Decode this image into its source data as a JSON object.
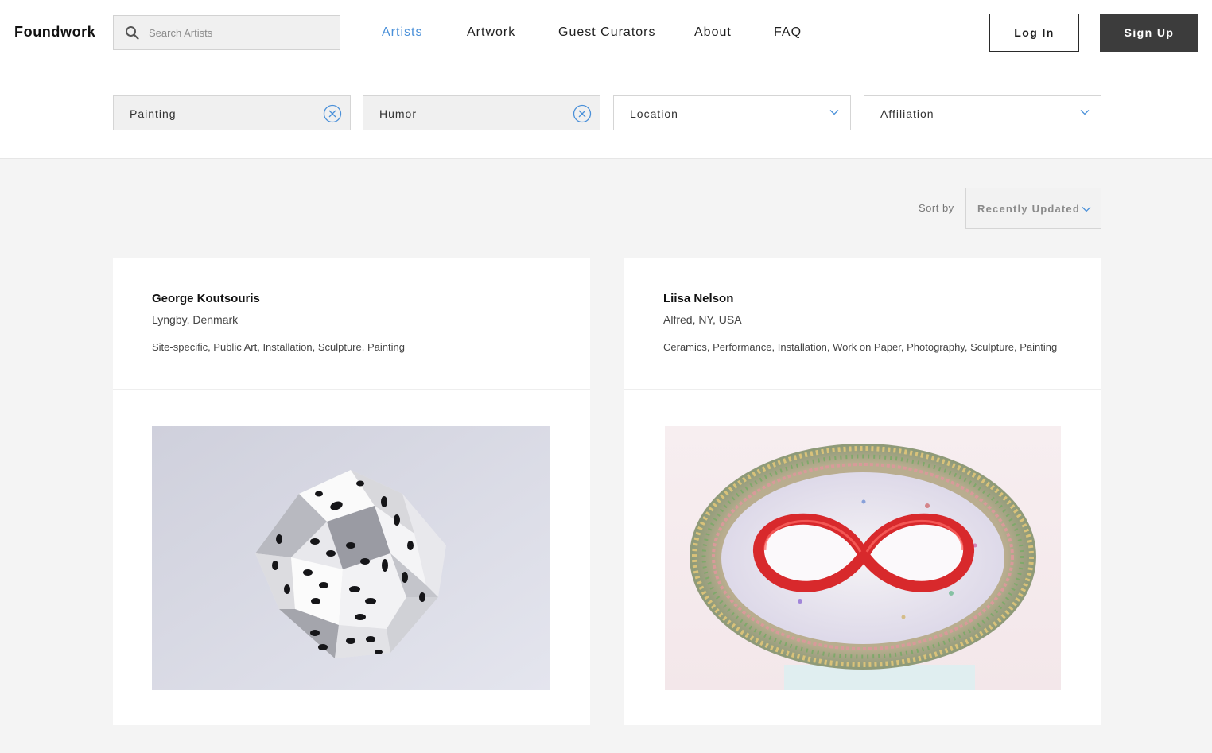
{
  "brand": {
    "logo": "Foundwork"
  },
  "search": {
    "placeholder": "Search Artists",
    "value": ""
  },
  "nav": {
    "items": [
      {
        "label": "Artists",
        "active": true
      },
      {
        "label": "Artwork",
        "active": false
      },
      {
        "label": "Guest Curators",
        "active": false
      },
      {
        "label": "About",
        "active": false
      },
      {
        "label": "FAQ",
        "active": false
      }
    ],
    "login_label": "Log In",
    "signup_label": "Sign Up"
  },
  "filters": {
    "active_chips": [
      "Painting",
      "Humor"
    ],
    "location_label": "Location",
    "affiliation_label": "Affiliation"
  },
  "sort": {
    "label": "Sort by",
    "value": "Recently Updated"
  },
  "artists": [
    {
      "name": "George Koutsouris",
      "location": "Lyngby, Denmark",
      "media": "Site-specific, Public Art, Installation, Sculpture, Painting",
      "artwork_icon": "dice-polyhedron-sculpture"
    },
    {
      "name": "Liisa Nelson",
      "location": "Alfred, NY, USA",
      "media": "Ceramics, Performance, Installation, Work on Paper, Photography, Sculpture, Painting",
      "artwork_icon": "ceramic-mask-sculpture"
    }
  ],
  "colors": {
    "accent": "#4a90d9",
    "signup_bg": "#3c3c3c",
    "page_bg": "#f4f4f4"
  }
}
